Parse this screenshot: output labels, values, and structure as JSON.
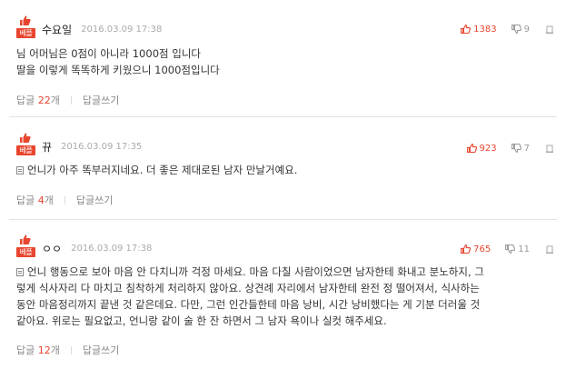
{
  "comments": [
    {
      "best_label": "베플",
      "nickname": "수요일",
      "date": "2016.03.09 17:38",
      "likes": "1383",
      "dislikes": "9",
      "lines": [
        "님 어머님은 0점이 아니라 1000점 입니다",
        "딸을 이렇게 똑똑하게 키웠으니 1000점입니다"
      ],
      "reply_label": "답글",
      "reply_count": "22",
      "reply_unit": "개",
      "write_reply": "답글쓰기"
    },
    {
      "best_label": "베플",
      "nickname": "뀨",
      "date": "2016.03.09 17:35",
      "likes": "923",
      "dislikes": "7",
      "lines": [
        "언니가 아주 똑부러지네요. 더 좋은 제대로된 남자 만날거예요."
      ],
      "reply_label": "답글",
      "reply_count": "4",
      "reply_unit": "개",
      "write_reply": "답글쓰기"
    },
    {
      "best_label": "베플",
      "nickname": "ㅇㅇ",
      "date": "2016.03.09 17:38",
      "likes": "765",
      "dislikes": "11",
      "lines": [
        "언니 행동으로 보아 마음 안 다치니까 걱정 마세요. 마음 다칠 사람이었으면 남자한테 화내고 분노하지, 그",
        "렇게 식사자리 다 마치고 침착하게 처리하지 않아요. 상견례 자리에서 남자한테 완전 정 떨어져서, 식사하는",
        "동안 마음정리까지 끝낸 것 같은데요. 다만, 그런 인간들한테 마음 낭비, 시간 낭비했다는 게 기분 더러울 것",
        "같아요. 위로는 필요없고, 언니랑 같이 술 한 잔 하면서 그 남자 욕이나 실컷 해주세요."
      ],
      "reply_label": "답글",
      "reply_count": "12",
      "reply_unit": "개",
      "write_reply": "답글쓰기"
    }
  ],
  "colors": {
    "accent": "#e8452f",
    "muted": "#888888",
    "date": "#aaaaaa",
    "separator": "#e3e3e3"
  },
  "icons": {
    "best": "thumbs-up-best-badge-icon",
    "like": "thumbs-up-icon",
    "dislike": "thumbs-down-icon",
    "report": "report-icon",
    "text": "document-icon"
  }
}
